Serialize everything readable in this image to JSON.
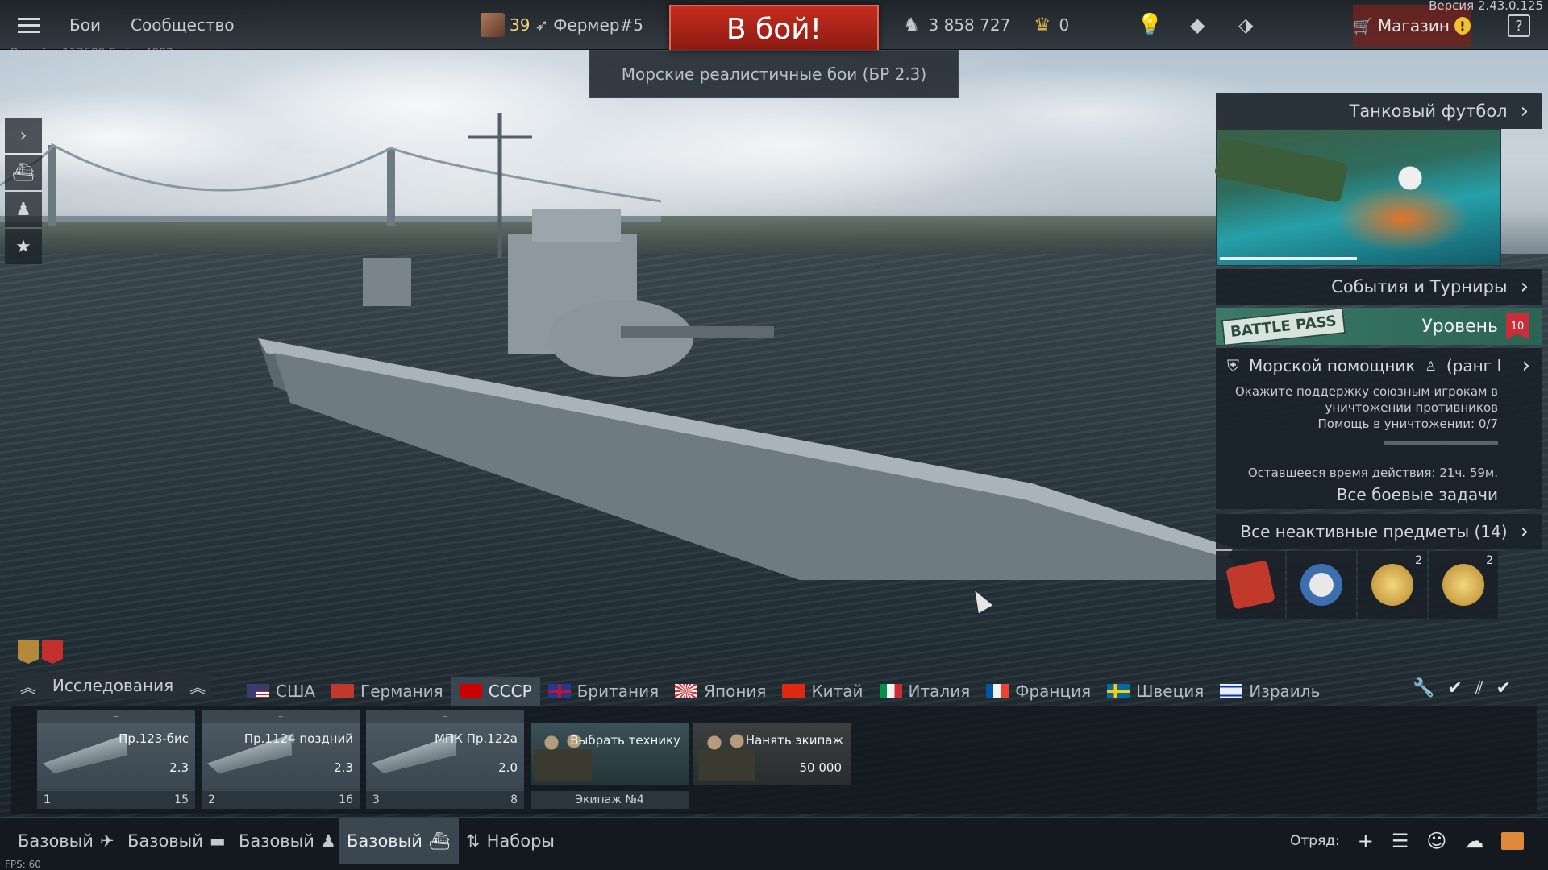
{
  "version": "Версия 2.43.0.125",
  "online_stats": "Онлайн: 113589  Боёв: 4083",
  "topbar": {
    "menu_battles": "Бои",
    "menu_community": "Сообщество",
    "player_level": "39",
    "player_name": "Фермер#5",
    "battle_button": "В бой!",
    "silver_lions": "3 858 727",
    "golden_eagles": "0",
    "shop_label": "Магазин",
    "help_label": "?"
  },
  "game_mode": "Морские реалистичные бои (БР 2.3)",
  "right_panel": {
    "event_title": "Танковый футбол",
    "events_tournaments": "События и Турниры",
    "battle_pass_logo": "BATTLE PASS",
    "battle_pass_level_label": "Уровень",
    "battle_pass_level": "10",
    "task_title": "Морской помощник",
    "task_rank": "(ранг I",
    "task_description_1": "Окажите поддержку союзным игрокам в",
    "task_description_2": "уничтожении противников",
    "task_progress_text": "Помощь в уничтожении: 0/7",
    "task_progress": 0.0,
    "task_time": "Оставшееся время действия: 21ч. 59м.",
    "all_tasks": "Все боевые задачи",
    "inactive_items": "Все неактивные предметы (14)",
    "items": [
      {
        "icon": "ticket-icon",
        "count": "",
        "color": "#c0392b"
      },
      {
        "icon": "hockey-player-icon",
        "count": "",
        "color": "#3d6fb0"
      },
      {
        "icon": "gold-medal-icon",
        "count": "2",
        "color": "#d4a23a"
      },
      {
        "icon": "gold-medal-icon",
        "count": "2",
        "color": "#d4a23a"
      }
    ]
  },
  "research": {
    "label": "Исследования"
  },
  "nations": [
    {
      "name": "США",
      "flag": "#3c3b6e"
    },
    {
      "name": "Германия",
      "flag": "#c0392b"
    },
    {
      "name": "СССР",
      "flag": "#cc0000",
      "active": true
    },
    {
      "name": "Британия",
      "flag": "#1f3a93"
    },
    {
      "name": "Япония",
      "flag": "#f5f5f5"
    },
    {
      "name": "Китай",
      "flag": "#de2910"
    },
    {
      "name": "Италия",
      "flag": "#009246"
    },
    {
      "name": "Франция",
      "flag": "#0055a4"
    },
    {
      "name": "Швеция",
      "flag": "#006aa7"
    },
    {
      "name": "Израиль",
      "flag": "#e8eef7"
    }
  ],
  "vehicles": [
    {
      "name": "Пр.123-бис",
      "br": "2.3",
      "crew_slot": "1",
      "count": "15"
    },
    {
      "name": "Пр.1124 поздний",
      "br": "2.3",
      "crew_slot": "2",
      "count": "16"
    },
    {
      "name": "МПК Пр.122а",
      "br": "2.0",
      "crew_slot": "3",
      "count": "8"
    }
  ],
  "select_vehicle": {
    "label": "Выбрать технику",
    "crew": "Экипаж №4"
  },
  "hire_crew": {
    "label": "Нанять экипаж",
    "price": "50 000"
  },
  "bottom_bar": {
    "presets": [
      "Базовый",
      "Базовый",
      "Базовый",
      "Базовый"
    ],
    "kits": "Наборы",
    "squad": "Отряд:",
    "fps": "FPS: 60"
  }
}
